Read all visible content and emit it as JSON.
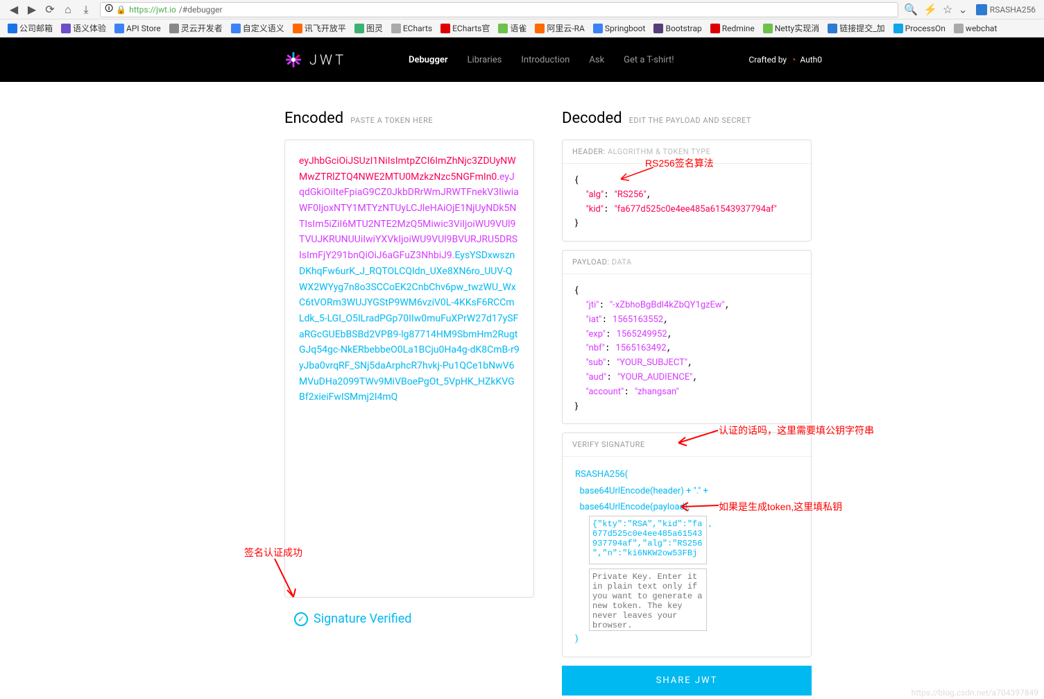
{
  "browser": {
    "url_proto": "https",
    "url_host": "://jwt.io",
    "url_path": "/#debugger",
    "extension_name": "RSASHA256"
  },
  "bookmarks": [
    {
      "label": "公司邮箱",
      "color": "#1a73e8"
    },
    {
      "label": "语义体验",
      "color": "#6e4ec9"
    },
    {
      "label": "API Store",
      "color": "#3b82f6"
    },
    {
      "label": "灵云开发者",
      "color": "#888"
    },
    {
      "label": "自定义语义",
      "color": "#3b82f6"
    },
    {
      "label": "讯飞开放平",
      "color": "#ff6a00"
    },
    {
      "label": "图灵",
      "color": "#3bb273"
    },
    {
      "label": "ECharts",
      "color": "#aaa"
    },
    {
      "label": "ECharts官",
      "color": "#d00"
    },
    {
      "label": "语雀",
      "color": "#6cc24a"
    },
    {
      "label": "阿里云-RA",
      "color": "#ff6a00"
    },
    {
      "label": "Springboot",
      "color": "#3b82f6"
    },
    {
      "label": "Bootstrap",
      "color": "#563d7c"
    },
    {
      "label": "Redmine",
      "color": "#d00"
    },
    {
      "label": "Netty实现消",
      "color": "#6cc24a"
    },
    {
      "label": "链接提交_加",
      "color": "#2e7ad0"
    },
    {
      "label": "ProcessOn",
      "color": "#0ea5e9"
    },
    {
      "label": "webchat",
      "color": "#aaa"
    }
  ],
  "header": {
    "logo": "JWT",
    "nav": [
      {
        "label": "Debugger",
        "active": true
      },
      {
        "label": "Libraries",
        "active": false
      },
      {
        "label": "Introduction",
        "active": false
      },
      {
        "label": "Ask",
        "active": false
      },
      {
        "label": "Get a T-shirt!",
        "active": false
      }
    ],
    "crafted": "Crafted by",
    "crafted_by": "Auth0"
  },
  "encoded": {
    "title": "Encoded",
    "sub": "PASTE A TOKEN HERE",
    "header_part": "eyJhbGciOiJSUzI1NiIsImtpZCI6ImZhNjc3ZDUyNWMwZTRlZTQ4NWE2MTU0MzkzNzc5NGFmIn0",
    "payload_part": "eyJqdGkiOiIteFpiaG9CZ0JkbDRrWmJRWTFnekV3IiwiaWF0IjoxNTY1MTYzNTUyLCJleHAiOjE1NjUyNDk5NTIsIm5iZiI6MTU2NTE2MzQ5Miwic3ViIjoiWU9VUl9TVUJKRUNUUiIwiYXVkIjoiWU9VUl9BVURJRU5DRSIsImFjY291bnQiOiJ6aGFuZ3NhbiJ9",
    "sig_part": "EysYSDxwsznDKhqFw6urK_J_RQTOLCQIdn_UXe8XN6ro_UUV-QWX2WYyg7n8o3SCCoEK2CnbChv6pw_twzWU_WxC6tVORm3WUJYGStP9WM6vziV0L-4KKsF6RCCmLdk_5-LGI_O5ILradPGp70IIw0muFuXPrW27d17ySFaRGcGUEbBSBd2VPB9-lg87714HM9SbmHm2RugtGJq54gc-NkERbebbeO0La1BCju0Ha4g-dK8CmB-r9yJba0vrqRF_SNj5daArphcR7hvkj-Pu1QCe1bNwV6MVuDHa2099TWv9MiVBoePgOt_5VpHK_HZkKVGBf2xieiFwISMmj2I4mQ"
  },
  "decoded": {
    "title": "Decoded",
    "sub": "EDIT THE PAYLOAD AND SECRET",
    "header_section": {
      "title": "HEADER:",
      "sub": "ALGORITHM & TOKEN TYPE",
      "alg_key": "\"alg\"",
      "alg_val": "\"RS256\"",
      "kid_key": "\"kid\"",
      "kid_val": "\"fa677d525c0e4ee485a61543937794af\""
    },
    "payload_section": {
      "title": "PAYLOAD:",
      "sub": "DATA",
      "entries": [
        {
          "k": "\"jti\"",
          "v": "\"-xZbhoBgBdl4kZbQY1gzEw\""
        },
        {
          "k": "\"iat\"",
          "v": "1565163552"
        },
        {
          "k": "\"exp\"",
          "v": "1565249952"
        },
        {
          "k": "\"nbf\"",
          "v": "1565163492"
        },
        {
          "k": "\"sub\"",
          "v": "\"YOUR_SUBJECT\""
        },
        {
          "k": "\"aud\"",
          "v": "\"YOUR_AUDIENCE\""
        },
        {
          "k": "\"account\"",
          "v": "\"zhangsan\""
        }
      ]
    },
    "signature_section": {
      "title": "VERIFY SIGNATURE",
      "alg": "RSASHA256(",
      "line1": "base64UrlEncode(header) + \".\" +",
      "line2": "base64UrlEncode(payload),",
      "pubkey": "{\"kty\":\"RSA\",\"kid\":\"fa677d525c0e4ee485a61543937794af\",\"alg\":\"RS256\",\"n\":\"ki6NKW2ow53FBj",
      "privkey": "Private Key. Enter it in plain text only if you want to generate a new token. The key never leaves your browser.",
      "close": ")"
    }
  },
  "verified": "Signature Verified",
  "share": "SHARE JWT",
  "annotations": {
    "a1": "RS256签名算法",
    "a2": "认证的话吗，这里需要填公钥字符串",
    "a3": "如果是生成token,这里填私钥",
    "a4": "签名认证成功"
  },
  "watermark": "https://blog.csdn.net/a704397849"
}
